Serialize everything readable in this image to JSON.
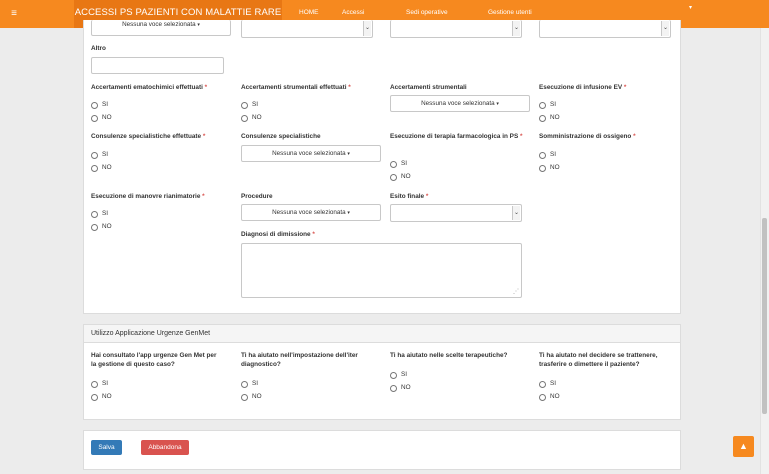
{
  "nav": {
    "menu_icon": "≡",
    "brand": "ACCESSI PS PAZIENTI CON MALATTIE RARE",
    "links": [
      "HOME",
      "Accessi",
      "Sedi operative",
      "Gestione utenti"
    ],
    "user_icon": "▾"
  },
  "form": {
    "top_multiselect": "Nessuna voce selezionata",
    "altro_label": "Altro",
    "q1": "Accertamenti ematochimici effettuati",
    "q2": "Accertamenti strumentali effettuati",
    "q3": "Accertamenti strumentali",
    "q4": "Esecuzione di infusione EV",
    "q5": "Consulenze specialistiche effettuate",
    "q6": "Consulenze specialistiche",
    "q7": "Esecuzione di terapia farmacologica in PS",
    "q8": "Somministrazione di ossigeno",
    "q9": "Esecuzione di manovre rianimatorie",
    "q10": "Procedure",
    "q11": "Esito finale",
    "q12": "Diagnosi di dimissione",
    "ms_none": "Nessuna voce selezionata",
    "required_mark": "*"
  },
  "opts": {
    "si": "SI",
    "no": "NO"
  },
  "genmet": {
    "title": "Utilizzo Applicazione Urgenze GenMet",
    "q1": "Hai consultato l'app urgenze Gen Met per la gestione di questo caso?",
    "q2": "Ti ha aiutato nell'impostazione dell'iter diagnostico?",
    "q3": "Ti ha aiutato nelle scelte terapeutiche?",
    "q4": "Ti ha aiutato nel decidere se trattenere, trasferire o dimettere il paziente?"
  },
  "actions": {
    "save": "Salva",
    "abandon": "Abbandona",
    "save_color": "#337ab7",
    "abandon_color": "#d9534f",
    "accent": "#f6891f"
  },
  "icons": {
    "caret": "▾",
    "select_arrow": "⌄",
    "scroll_top": "▲",
    "resize": "⋰"
  }
}
